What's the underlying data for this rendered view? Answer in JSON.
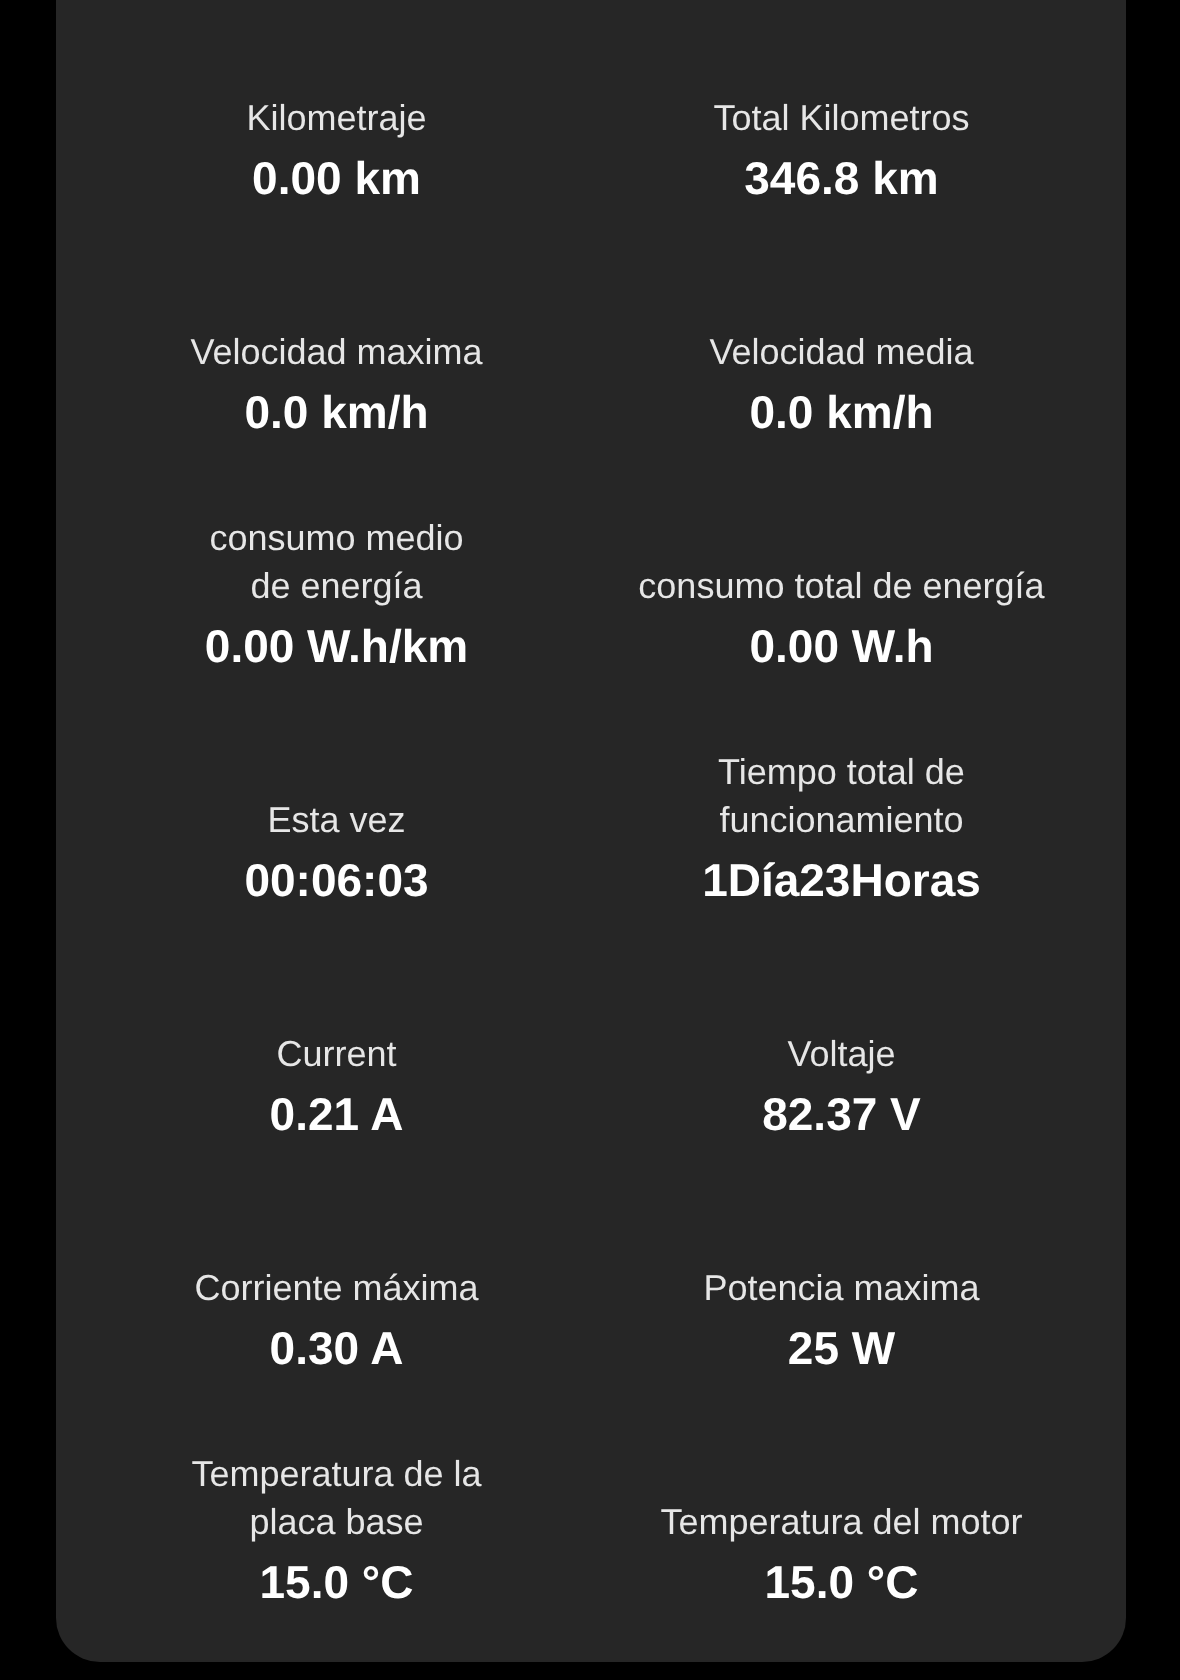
{
  "rows": [
    {
      "cells": [
        {
          "label": "Kilometraje",
          "value": "0.00 km"
        },
        {
          "label": "Total Kilometros",
          "value": "346.8 km"
        }
      ]
    },
    {
      "cells": [
        {
          "label": "Velocidad maxima",
          "value": "0.0 km/h"
        },
        {
          "label": "Velocidad media",
          "value": "0.0 km/h"
        }
      ]
    },
    {
      "cells": [
        {
          "label": "consumo medio\nde energía",
          "value": "0.00 W.h/km"
        },
        {
          "label": "consumo total de energía",
          "value": "0.00 W.h"
        }
      ]
    },
    {
      "cells": [
        {
          "label": "Esta vez",
          "value": "00:06:03"
        },
        {
          "label": "Tiempo total de\nfuncionamiento",
          "value": "1Día23Horas"
        }
      ]
    },
    {
      "cells": [
        {
          "label": "Current",
          "value": "0.21 A"
        },
        {
          "label": "Voltaje",
          "value": "82.37 V"
        }
      ]
    },
    {
      "cells": [
        {
          "label": "Corriente máxima",
          "value": "0.30 A"
        },
        {
          "label": "Potencia maxima",
          "value": "25 W"
        }
      ]
    },
    {
      "cells": [
        {
          "label": "Temperatura de la\nplaca base",
          "value": "15.0 °C"
        },
        {
          "label": "Temperatura del motor",
          "value": "15.0 °C"
        }
      ]
    }
  ]
}
